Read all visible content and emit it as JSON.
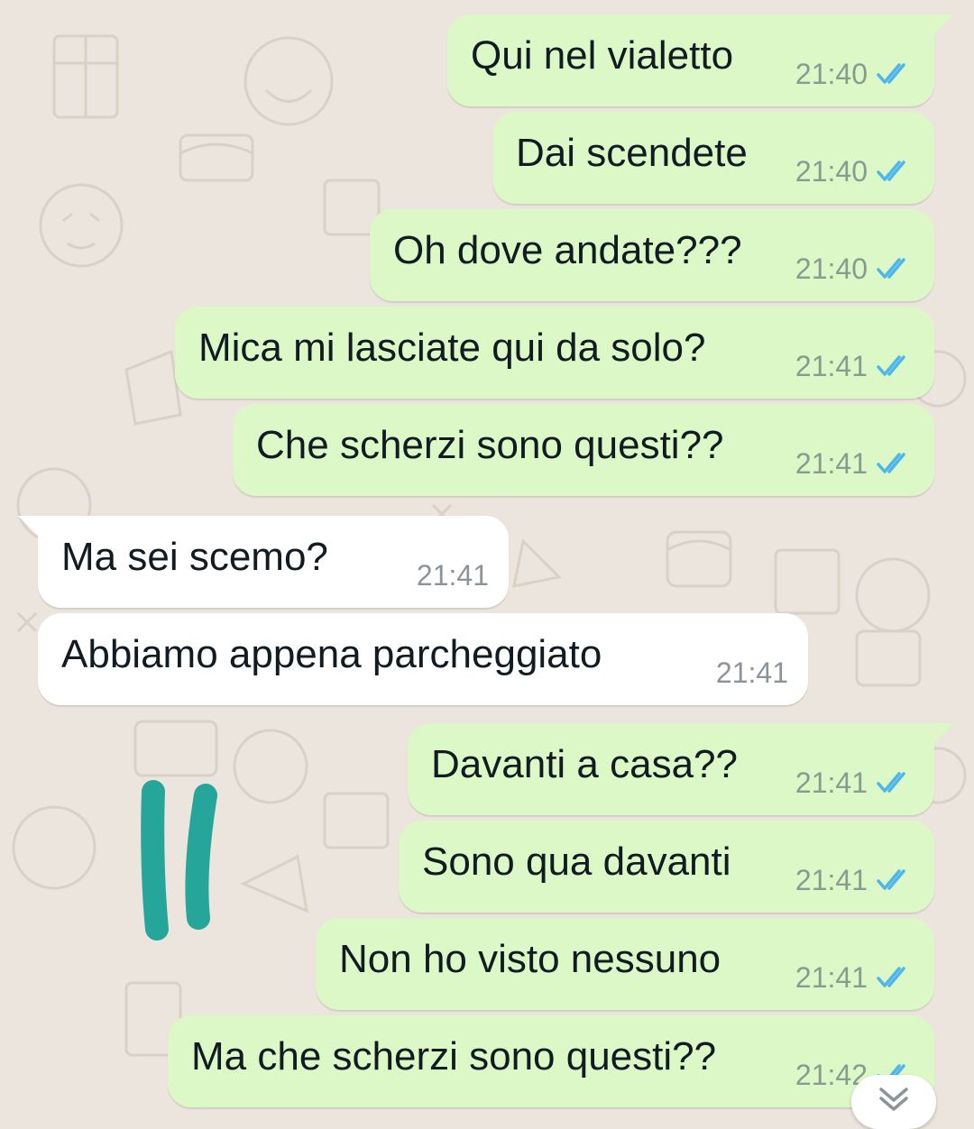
{
  "chat": {
    "messages": [
      {
        "direction": "outgoing",
        "text": "Qui nel vialetto",
        "time": "21:40",
        "status": "read"
      },
      {
        "direction": "outgoing",
        "text": "Dai scendete",
        "time": "21:40",
        "status": "read"
      },
      {
        "direction": "outgoing",
        "text": "Oh dove andate???",
        "time": "21:40",
        "status": "read"
      },
      {
        "direction": "outgoing",
        "text": "Mica mi lasciate qui da solo?",
        "time": "21:41",
        "status": "read"
      },
      {
        "direction": "outgoing",
        "text": "Che scherzi sono questi??",
        "time": "21:41",
        "status": "read"
      },
      {
        "direction": "incoming",
        "text": "Ma sei scemo?",
        "time": "21:41"
      },
      {
        "direction": "incoming",
        "text": "Abbiamo appena parcheggiato",
        "time": "21:41"
      },
      {
        "direction": "outgoing",
        "text": "Davanti a casa??",
        "time": "21:41",
        "status": "read"
      },
      {
        "direction": "outgoing",
        "text": "Sono qua davanti",
        "time": "21:41",
        "status": "read"
      },
      {
        "direction": "outgoing",
        "text": "Non ho visto nessuno",
        "time": "21:41",
        "status": "read"
      },
      {
        "direction": "outgoing",
        "text": "Ma che scherzi sono questi??",
        "time": "21:42",
        "status": "read"
      }
    ]
  },
  "icons": {
    "read_ticks": "double-check-icon",
    "scroll_down": "chevron-down-icon"
  },
  "colors": {
    "outgoing_bubble": "#dcf8c6",
    "incoming_bubble": "#ffffff",
    "read_tick": "#4fb6ec",
    "annotation_marker": "#26a69a",
    "chat_background": "#ece5dd"
  }
}
